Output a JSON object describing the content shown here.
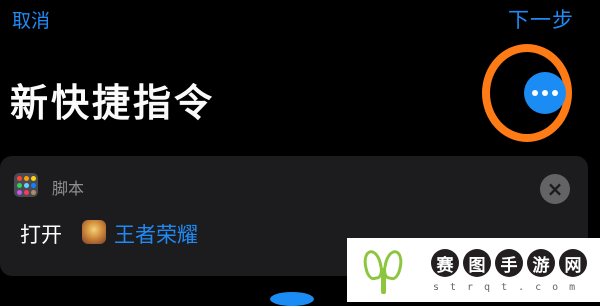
{
  "nav": {
    "cancel_label": "取消",
    "next_label": "下一步"
  },
  "page": {
    "title": "新快捷指令"
  },
  "more_button": {
    "icon": "ellipsis-icon",
    "highlight_color": "#ff7b16",
    "color": "#1c8cf5"
  },
  "action": {
    "category_icon": "script-grid-icon",
    "category": "脚本",
    "verb": "打开",
    "app_icon": "honor-of-kings-app-icon",
    "app_name": "王者荣耀",
    "remove_icon": "close-icon"
  },
  "watermark": {
    "characters": [
      "赛",
      "图",
      "手",
      "游",
      "网"
    ],
    "url": "strqt.com"
  },
  "colors": {
    "accent": "#1f8af5",
    "background": "#000000",
    "card": "#1c1c1e"
  }
}
